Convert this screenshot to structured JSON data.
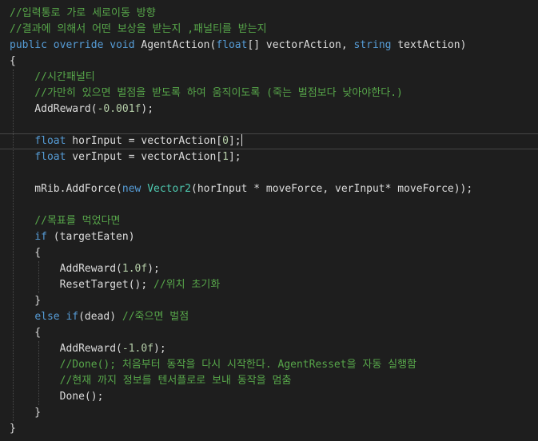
{
  "editor": {
    "colors": {
      "background": "#1e1e1e",
      "keyword": "#569cd6",
      "type": "#4ec9b0",
      "comment": "#57a64a",
      "number": "#b5cea8",
      "plain": "#dcdcdc"
    },
    "current_line_index": 8,
    "lines": [
      [
        {
          "t": "//입력통로 가로 세로이동 방향",
          "k": "cm"
        }
      ],
      [
        {
          "t": "//결과에 의해서 어떤 보상을 받는지 ,패널티를 받는지",
          "k": "cm"
        }
      ],
      [
        {
          "t": "public",
          "k": "kw"
        },
        {
          "t": " ",
          "k": "pl"
        },
        {
          "t": "override",
          "k": "kw"
        },
        {
          "t": " ",
          "k": "pl"
        },
        {
          "t": "void",
          "k": "kw"
        },
        {
          "t": " AgentAction(",
          "k": "pl"
        },
        {
          "t": "float",
          "k": "kw"
        },
        {
          "t": "[] vectorAction, ",
          "k": "pl"
        },
        {
          "t": "string",
          "k": "kw"
        },
        {
          "t": " textAction)",
          "k": "pl"
        }
      ],
      [
        {
          "t": "{",
          "k": "pl"
        }
      ],
      [
        {
          "t": "    //시간패널티",
          "k": "cm"
        }
      ],
      [
        {
          "t": "    //가만히 있으면 벌점을 받도록 하여 움직이도록 (죽는 벌점보다 낮아야한다.)",
          "k": "cm"
        }
      ],
      [
        {
          "t": "    AddReward(",
          "k": "pl"
        },
        {
          "t": "-0.001f",
          "k": "nm"
        },
        {
          "t": ");",
          "k": "pl"
        }
      ],
      [],
      [
        {
          "t": "    ",
          "k": "pl"
        },
        {
          "t": "float",
          "k": "kw"
        },
        {
          "t": " horInput = vectorAction[",
          "k": "pl"
        },
        {
          "t": "0",
          "k": "nm"
        },
        {
          "t": "];",
          "k": "pl"
        }
      ],
      [
        {
          "t": "    ",
          "k": "pl"
        },
        {
          "t": "float",
          "k": "kw"
        },
        {
          "t": " verInput = vectorAction[",
          "k": "pl"
        },
        {
          "t": "1",
          "k": "nm"
        },
        {
          "t": "];",
          "k": "pl"
        }
      ],
      [],
      [
        {
          "t": "    mRib.AddForce(",
          "k": "pl"
        },
        {
          "t": "new",
          "k": "kw"
        },
        {
          "t": " ",
          "k": "pl"
        },
        {
          "t": "Vector2",
          "k": "ty"
        },
        {
          "t": "(horInput * moveForce, verInput* moveForce));",
          "k": "pl"
        }
      ],
      [],
      [
        {
          "t": "    //목표를 먹었다면",
          "k": "cm"
        }
      ],
      [
        {
          "t": "    ",
          "k": "pl"
        },
        {
          "t": "if",
          "k": "kw"
        },
        {
          "t": " (targetEaten)",
          "k": "pl"
        }
      ],
      [
        {
          "t": "    {",
          "k": "pl"
        }
      ],
      [
        {
          "t": "        AddReward(",
          "k": "pl"
        },
        {
          "t": "1.0f",
          "k": "nm"
        },
        {
          "t": ");",
          "k": "pl"
        }
      ],
      [
        {
          "t": "        ResetTarget(); ",
          "k": "pl"
        },
        {
          "t": "//위치 초기화",
          "k": "cm"
        }
      ],
      [
        {
          "t": "    }",
          "k": "pl"
        }
      ],
      [
        {
          "t": "    ",
          "k": "pl"
        },
        {
          "t": "else",
          "k": "kw"
        },
        {
          "t": " ",
          "k": "pl"
        },
        {
          "t": "if",
          "k": "kw"
        },
        {
          "t": "(dead) ",
          "k": "pl"
        },
        {
          "t": "//죽으면 벌점",
          "k": "cm"
        }
      ],
      [
        {
          "t": "    {",
          "k": "pl"
        }
      ],
      [
        {
          "t": "        AddReward(",
          "k": "pl"
        },
        {
          "t": "-1.0f",
          "k": "nm"
        },
        {
          "t": ");",
          "k": "pl"
        }
      ],
      [
        {
          "t": "        //Done(); 처음부터 동작을 다시 시작한다. AgentResset을 자동 실행함",
          "k": "cm"
        }
      ],
      [
        {
          "t": "        //현재 까지 정보를 텐서플로로 보내 동작을 멈춤",
          "k": "cm"
        }
      ],
      [
        {
          "t": "        Done();",
          "k": "pl"
        }
      ],
      [
        {
          "t": "    }",
          "k": "pl"
        }
      ],
      [
        {
          "t": "}",
          "k": "pl"
        }
      ]
    ]
  }
}
